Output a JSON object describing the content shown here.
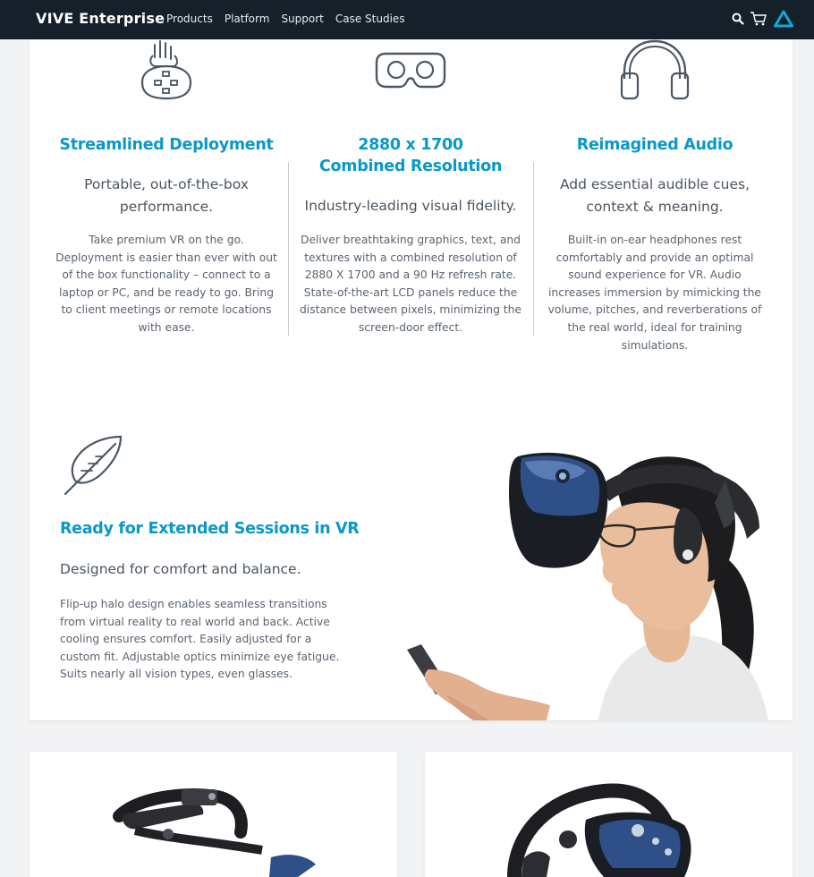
{
  "nav": {
    "brand": "VIVE Enterprise",
    "links": [
      "Products",
      "Platform",
      "Support",
      "Case Studies"
    ],
    "icons": [
      "search-icon",
      "cart-icon",
      "vive-logo-icon"
    ]
  },
  "features": [
    {
      "icon": "hand-controller-icon",
      "title_lines": [
        "Streamlined Deployment"
      ],
      "subtitle_lines": [
        "Portable, out-of-the-box",
        "performance."
      ],
      "body_lines": [
        "Take premium VR on the go.",
        "Deployment is easier than ever with out",
        "of the box functionality – connect to a",
        "laptop or PC, and be ready to go. Bring",
        "to client meetings or remote locations",
        "with ease."
      ]
    },
    {
      "icon": "vr-goggles-icon",
      "title_lines": [
        "2880 x 1700",
        "Combined Resolution"
      ],
      "subtitle_lines": [
        "Industry-leading visual fidelity."
      ],
      "body_lines": [
        "Deliver breathtaking graphics, text, and",
        "textures with a combined resolution of",
        "2880 X 1700 and a 90 Hz refresh rate.",
        "State-of-the-art LCD panels reduce the",
        "distance between pixels, minimizing the",
        "screen-door effect."
      ]
    },
    {
      "icon": "headphones-icon",
      "title_lines": [
        "Reimagined Audio"
      ],
      "subtitle_lines": [
        "Add essential audible cues,",
        "context & meaning."
      ],
      "body_lines": [
        "Built-in on-ear headphones rest",
        "comfortably and provide an optimal",
        "sound experience for VR. Audio",
        "increases immersion by mimicking the",
        "volume, pitches, and reverberations of",
        "the real world, ideal for training",
        "simulations."
      ]
    }
  ],
  "extended": {
    "icon": "feather-icon",
    "title": "Ready for Extended Sessions in VR",
    "subtitle": "Designed for comfort and balance.",
    "body_lines": [
      "Flip-up halo design enables seamless transitions",
      "from virtual reality to real world and back. Active",
      "cooling ensures comfort. Easily adjusted for a",
      "custom fit. Adjustable optics minimize eye fatigue.",
      "Suits nearly all vision types, even glasses."
    ]
  },
  "colors": {
    "nav_bg": "#16202b",
    "accent": "#0a98c8",
    "page_bg": "#f2f3f5"
  }
}
